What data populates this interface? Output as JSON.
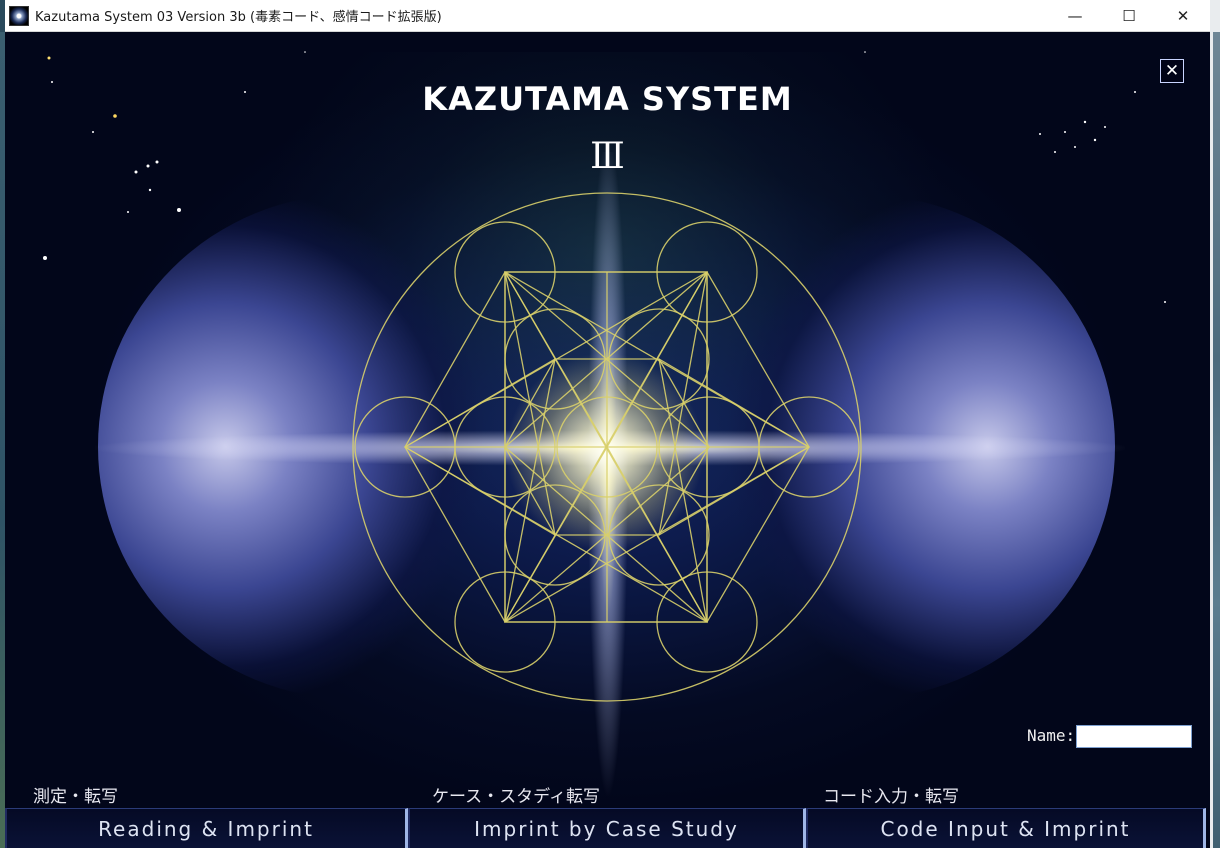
{
  "window": {
    "title": "Kazutama System 03 Version 3b (毒素コード、感情コード拡張版)",
    "controls": {
      "minimize": "—",
      "maximize": "☐",
      "close": "✕"
    }
  },
  "logo": {
    "title": "KAZUTAMA SYSTEM",
    "numeral": "Ⅲ"
  },
  "panel_close": "✕",
  "name_field": {
    "label": "Name:",
    "value": ""
  },
  "sections": [
    {
      "label": "測定・転写",
      "button": "Reading & Imprint"
    },
    {
      "label": "ケース・スタディ転写",
      "button": "Imprint by Case Study"
    },
    {
      "label": "コード入力・転写",
      "button": "Code Input & Imprint"
    }
  ],
  "colors": {
    "accent_gold": "#d8cf6a",
    "button_border": "#9fb6e6"
  }
}
